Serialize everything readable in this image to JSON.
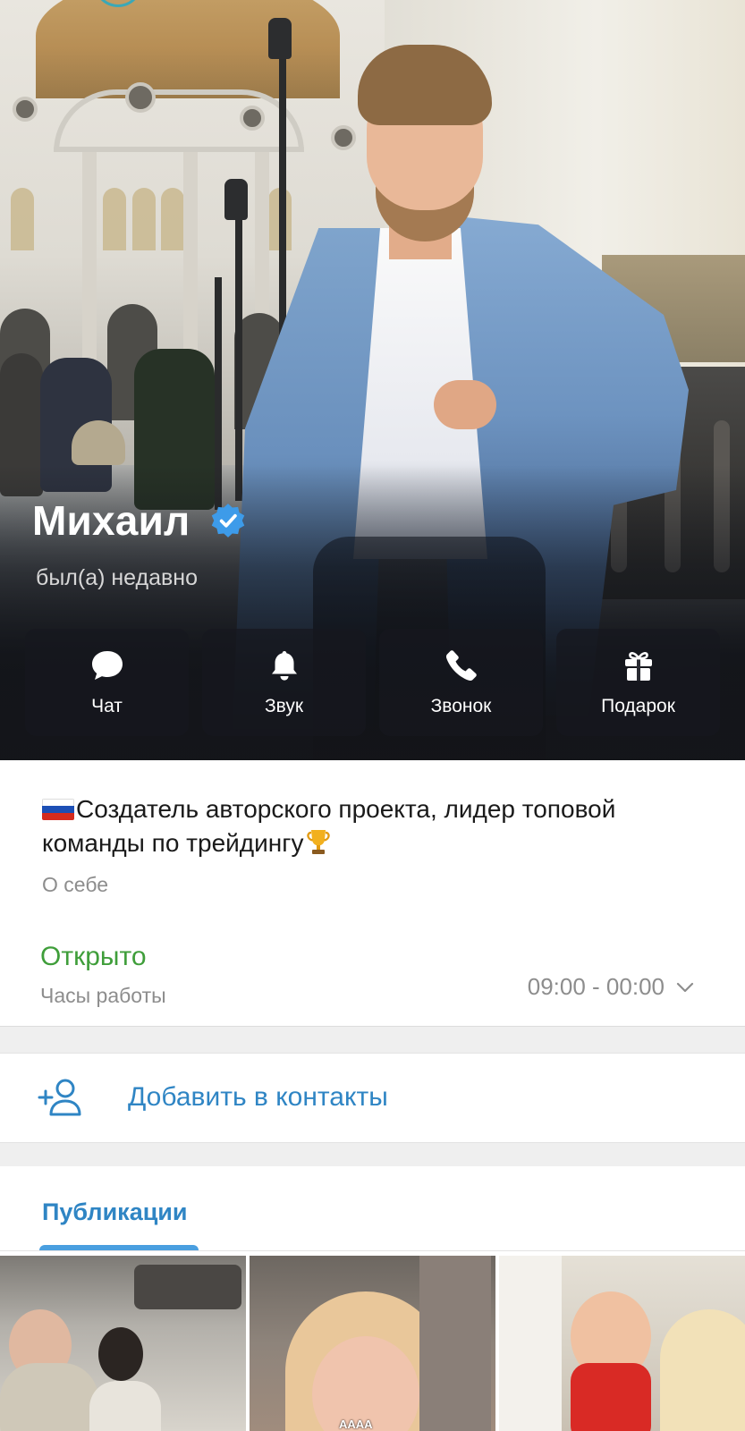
{
  "profile": {
    "name": "Михаил",
    "status": "был(а) недавно",
    "verified": true,
    "verified_color": "#3d9be9"
  },
  "actions": [
    {
      "label": "Чат",
      "icon": "chat-bubble-icon"
    },
    {
      "label": "Звук",
      "icon": "bell-icon"
    },
    {
      "label": "Звонок",
      "icon": "phone-icon"
    },
    {
      "label": "Подарок",
      "icon": "gift-icon"
    }
  ],
  "about": {
    "bio": "Создатель авторского проекта, лидер топовой команды по трейдингу",
    "bio_prefix_icon": "russia-flag-icon",
    "bio_suffix_icon": "trophy-icon",
    "bio_label": "О себе",
    "open_status": "Открыто",
    "open_color": "#3f9e3a",
    "hours_label": "Часы работы",
    "hours_value": "09:00 - 00:00"
  },
  "add_contact": {
    "label": "Добавить в контакты",
    "icon": "add-person-icon",
    "color": "#2f85c4"
  },
  "publications": {
    "tab_label": "Публикации",
    "thumbnails": [
      {
        "caption": ""
      },
      {
        "caption": "AAAA"
      },
      {
        "caption": ""
      }
    ]
  }
}
